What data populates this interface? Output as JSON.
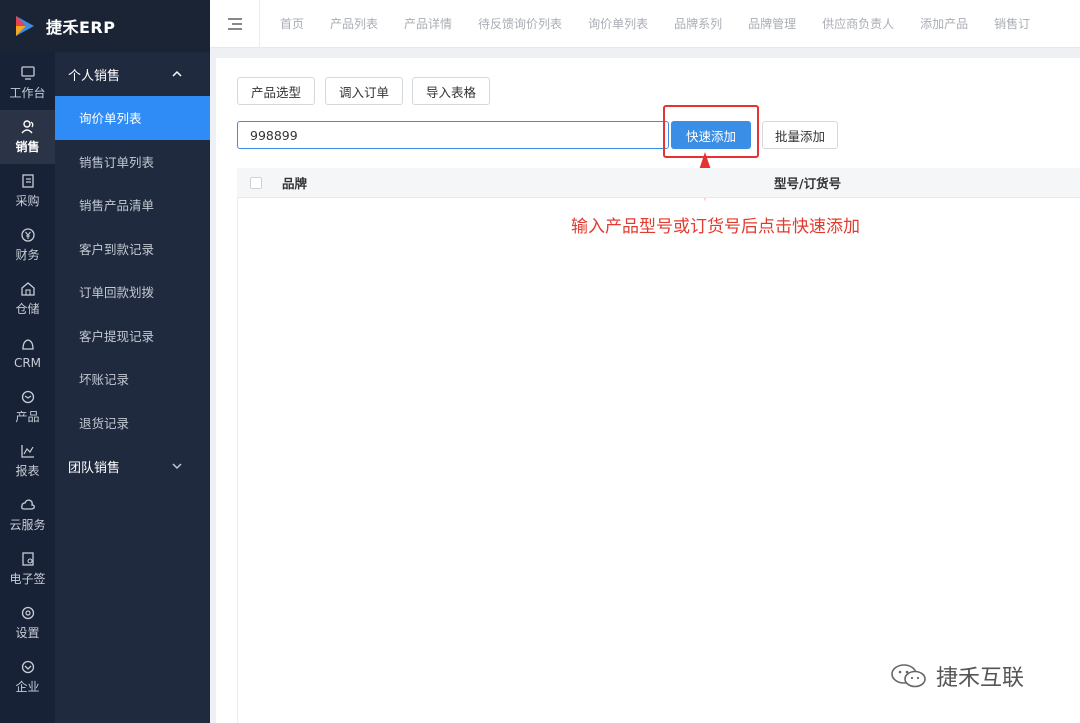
{
  "app": {
    "logo_text": "捷禾ERP"
  },
  "rail": [
    {
      "label": "工作台",
      "icon": "monitor-icon"
    },
    {
      "label": "销售",
      "icon": "users-icon",
      "active": true
    },
    {
      "label": "采购",
      "icon": "clipboard-icon"
    },
    {
      "label": "财务",
      "icon": "yen-icon"
    },
    {
      "label": "仓储",
      "icon": "warehouse-icon"
    },
    {
      "label": "CRM",
      "icon": "crm-icon"
    },
    {
      "label": "产品",
      "icon": "cube-icon"
    },
    {
      "label": "报表",
      "icon": "chart-icon"
    },
    {
      "label": "云服务",
      "icon": "cloud-icon"
    },
    {
      "label": "电子签",
      "icon": "esign-icon"
    },
    {
      "label": "设置",
      "icon": "settings-icon"
    },
    {
      "label": "企业",
      "icon": "enterprise-icon"
    }
  ],
  "submenu": {
    "group1": "个人销售",
    "items": [
      "询价单列表",
      "销售订单列表",
      "销售产品清单",
      "客户到款记录",
      "订单回款划拨",
      "客户提现记录",
      "坏账记录",
      "退货记录"
    ],
    "group2": "团队销售"
  },
  "tabs": [
    "首页",
    "产品列表",
    "产品详情",
    "待反馈询价列表",
    "询价单列表",
    "品牌系列",
    "品牌管理",
    "供应商负责人",
    "添加产品",
    "销售订"
  ],
  "toolbar": {
    "product_select": "产品选型",
    "import_order": "调入订单",
    "import_sheet": "导入表格",
    "search_value": "998899",
    "quick_add": "快速添加",
    "batch_add": "批量添加"
  },
  "annotation": "输入产品型号或订货号后点击快速添加",
  "table": {
    "columns": [
      "品牌",
      "型号/订货号"
    ]
  },
  "watermark": "捷禾互联",
  "colors": {
    "accent": "#3a8ee6",
    "annotation": "#e23a2f",
    "sidebar": "#1f2a3f"
  }
}
